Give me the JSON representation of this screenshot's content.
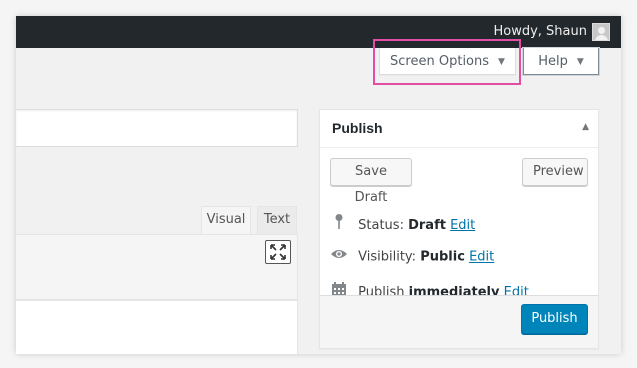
{
  "admin_bar": {
    "greeting": "Howdy, Shaun",
    "avatar_icon": "user-avatar-icon"
  },
  "screen_meta": {
    "screen_options_label": "Screen Options",
    "help_label": "Help",
    "caret_icon": "▼",
    "highlight_color": "#e24ea4"
  },
  "editor": {
    "tabs": [
      {
        "label": "Visual"
      },
      {
        "label": "Text"
      }
    ],
    "fullscreen_icon": "expand-icon"
  },
  "publish": {
    "title": "Publish",
    "toggle_icon": "▲",
    "save_draft_label": "Save Draft",
    "preview_label": "Preview",
    "status": {
      "label": "Status:",
      "value": "Draft",
      "edit": "Edit"
    },
    "visibility": {
      "label": "Visibility:",
      "value": "Public",
      "edit": "Edit"
    },
    "schedule": {
      "label": "Publish",
      "value": "immediately",
      "edit": "Edit"
    },
    "publish_button_label": "Publish",
    "primary_color": "#0085ba",
    "link_color": "#0073aa"
  }
}
